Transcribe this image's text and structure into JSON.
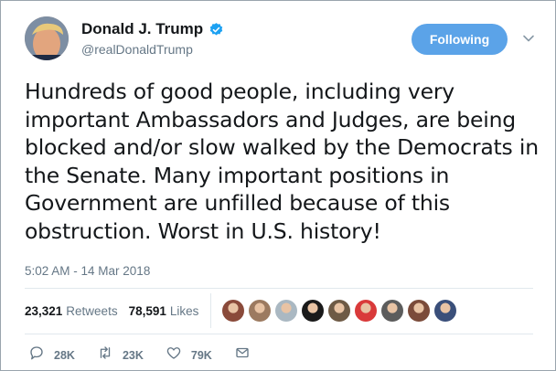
{
  "author": {
    "display_name": "Donald J. Trump",
    "handle": "@realDonaldTrump",
    "verified_icon": "verified-badge-icon"
  },
  "follow_button": {
    "label": "Following"
  },
  "tweet": {
    "text": "Hundreds of good people, including very important Ambassadors and Judges, are being blocked and/or slow walked by the Democrats in the Senate. Many important positions in Government are unfilled because of this obstruction. Worst in U.S. history!",
    "timestamp": "5:02 AM - 14 Mar 2018"
  },
  "stats": {
    "retweets_count": "23,321",
    "retweets_label": "Retweets",
    "likes_count": "78,591",
    "likes_label": "Likes"
  },
  "liker_avatars": [
    {
      "name": "liker-avatar-1",
      "color": "#8a4a3a"
    },
    {
      "name": "liker-avatar-2",
      "color": "#9c7a60"
    },
    {
      "name": "liker-avatar-3",
      "color": "#aab8c2"
    },
    {
      "name": "liker-avatar-4",
      "color": "#1a1a1a"
    },
    {
      "name": "liker-avatar-5",
      "color": "#6e5a45"
    },
    {
      "name": "liker-avatar-6",
      "color": "#d93a3a"
    },
    {
      "name": "liker-avatar-7",
      "color": "#5c5c5c"
    },
    {
      "name": "liker-avatar-8",
      "color": "#7b4b3a"
    },
    {
      "name": "liker-avatar-9",
      "color": "#3a4f7a"
    }
  ],
  "actions": {
    "reply_count": "28K",
    "retweet_count": "23K",
    "like_count": "79K"
  },
  "colors": {
    "accent": "#1da1f2",
    "following_button": "#5ba3e8",
    "secondary_text": "#657786",
    "border": "#e1e8ed"
  }
}
